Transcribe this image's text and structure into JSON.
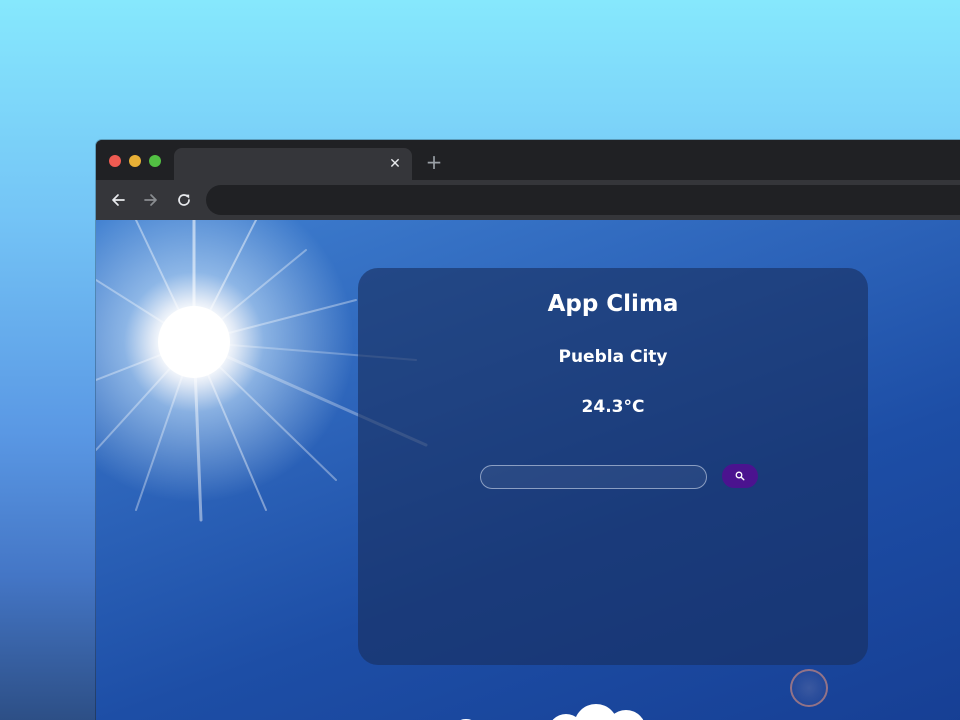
{
  "browser": {
    "tab": {
      "title": "",
      "close_glyph": "✕",
      "close_icon": "close-icon"
    },
    "new_tab_glyph": "+",
    "new_tab_icon": "plus-icon",
    "nav": {
      "back_icon": "arrow-left-icon",
      "forward_icon": "arrow-right-icon",
      "reload_icon": "reload-icon"
    },
    "address_bar": {
      "value": ""
    }
  },
  "app": {
    "title": "App Clima",
    "city": "Puebla City",
    "temperature": "24.3°C",
    "search": {
      "value": "",
      "placeholder": ""
    },
    "search_button_icon": "search-icon",
    "colors": {
      "search_button": "#4b138f",
      "card_background": "#182e5f"
    }
  }
}
